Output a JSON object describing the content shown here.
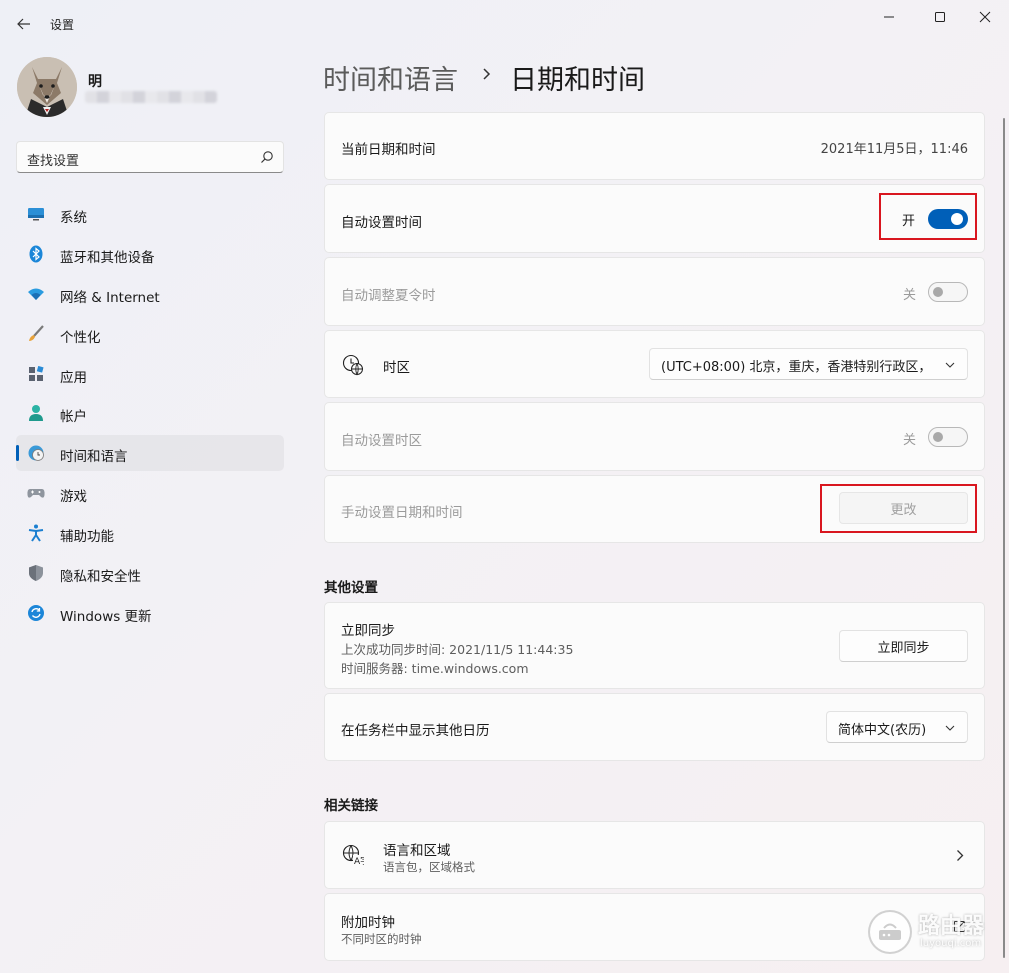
{
  "window": {
    "title": "设置",
    "minimize_icon": "minimize-icon",
    "maximize_icon": "maximize-icon",
    "close_icon": "close-icon"
  },
  "user": {
    "name": "明"
  },
  "search": {
    "placeholder": "查找设置"
  },
  "sidebar": {
    "items": [
      {
        "label": "系统",
        "icon": "monitor-icon"
      },
      {
        "label": "蓝牙和其他设备",
        "icon": "bluetooth-icon"
      },
      {
        "label": "网络 & Internet",
        "icon": "wifi-icon"
      },
      {
        "label": "个性化",
        "icon": "brush-icon"
      },
      {
        "label": "应用",
        "icon": "apps-icon"
      },
      {
        "label": "帐户",
        "icon": "person-icon"
      },
      {
        "label": "时间和语言",
        "icon": "globe-clock-icon",
        "active": true
      },
      {
        "label": "游戏",
        "icon": "gamepad-icon"
      },
      {
        "label": "辅助功能",
        "icon": "accessibility-icon"
      },
      {
        "label": "隐私和安全性",
        "icon": "shield-icon"
      },
      {
        "label": "Windows 更新",
        "icon": "update-icon"
      }
    ]
  },
  "breadcrumb": {
    "parent": "时间和语言",
    "current": "日期和时间"
  },
  "settings": {
    "current_datetime": {
      "label": "当前日期和时间",
      "value": "2021年11月5日，11:46"
    },
    "auto_time": {
      "label": "自动设置时间",
      "state": "开",
      "on": true
    },
    "auto_dst": {
      "label": "自动调整夏令时",
      "state": "关",
      "on": false
    },
    "timezone": {
      "label": "时区",
      "value": "(UTC+08:00) 北京，重庆，香港特别行政区，"
    },
    "auto_timezone": {
      "label": "自动设置时区",
      "state": "关",
      "on": false
    },
    "manual_datetime": {
      "label": "手动设置日期和时间",
      "button": "更改"
    }
  },
  "other": {
    "title": "其他设置",
    "sync": {
      "label": "立即同步",
      "last_sync": "上次成功同步时间: 2021/11/5 11:44:35",
      "server": "时间服务器: time.windows.com",
      "button": "立即同步"
    },
    "calendar": {
      "label": "在任务栏中显示其他日历",
      "value": "简体中文(农历)"
    }
  },
  "related": {
    "title": "相关链接",
    "language_region": {
      "label": "语言和区域",
      "sub": "语言包，区域格式"
    },
    "extra_clocks": {
      "label": "附加时钟",
      "sub": "不同时区的时钟"
    }
  },
  "watermark": {
    "title": "路由器",
    "url": "luyouqi.com"
  },
  "colors": {
    "accent": "#005fb8",
    "highlight_box": "#d9161f"
  }
}
